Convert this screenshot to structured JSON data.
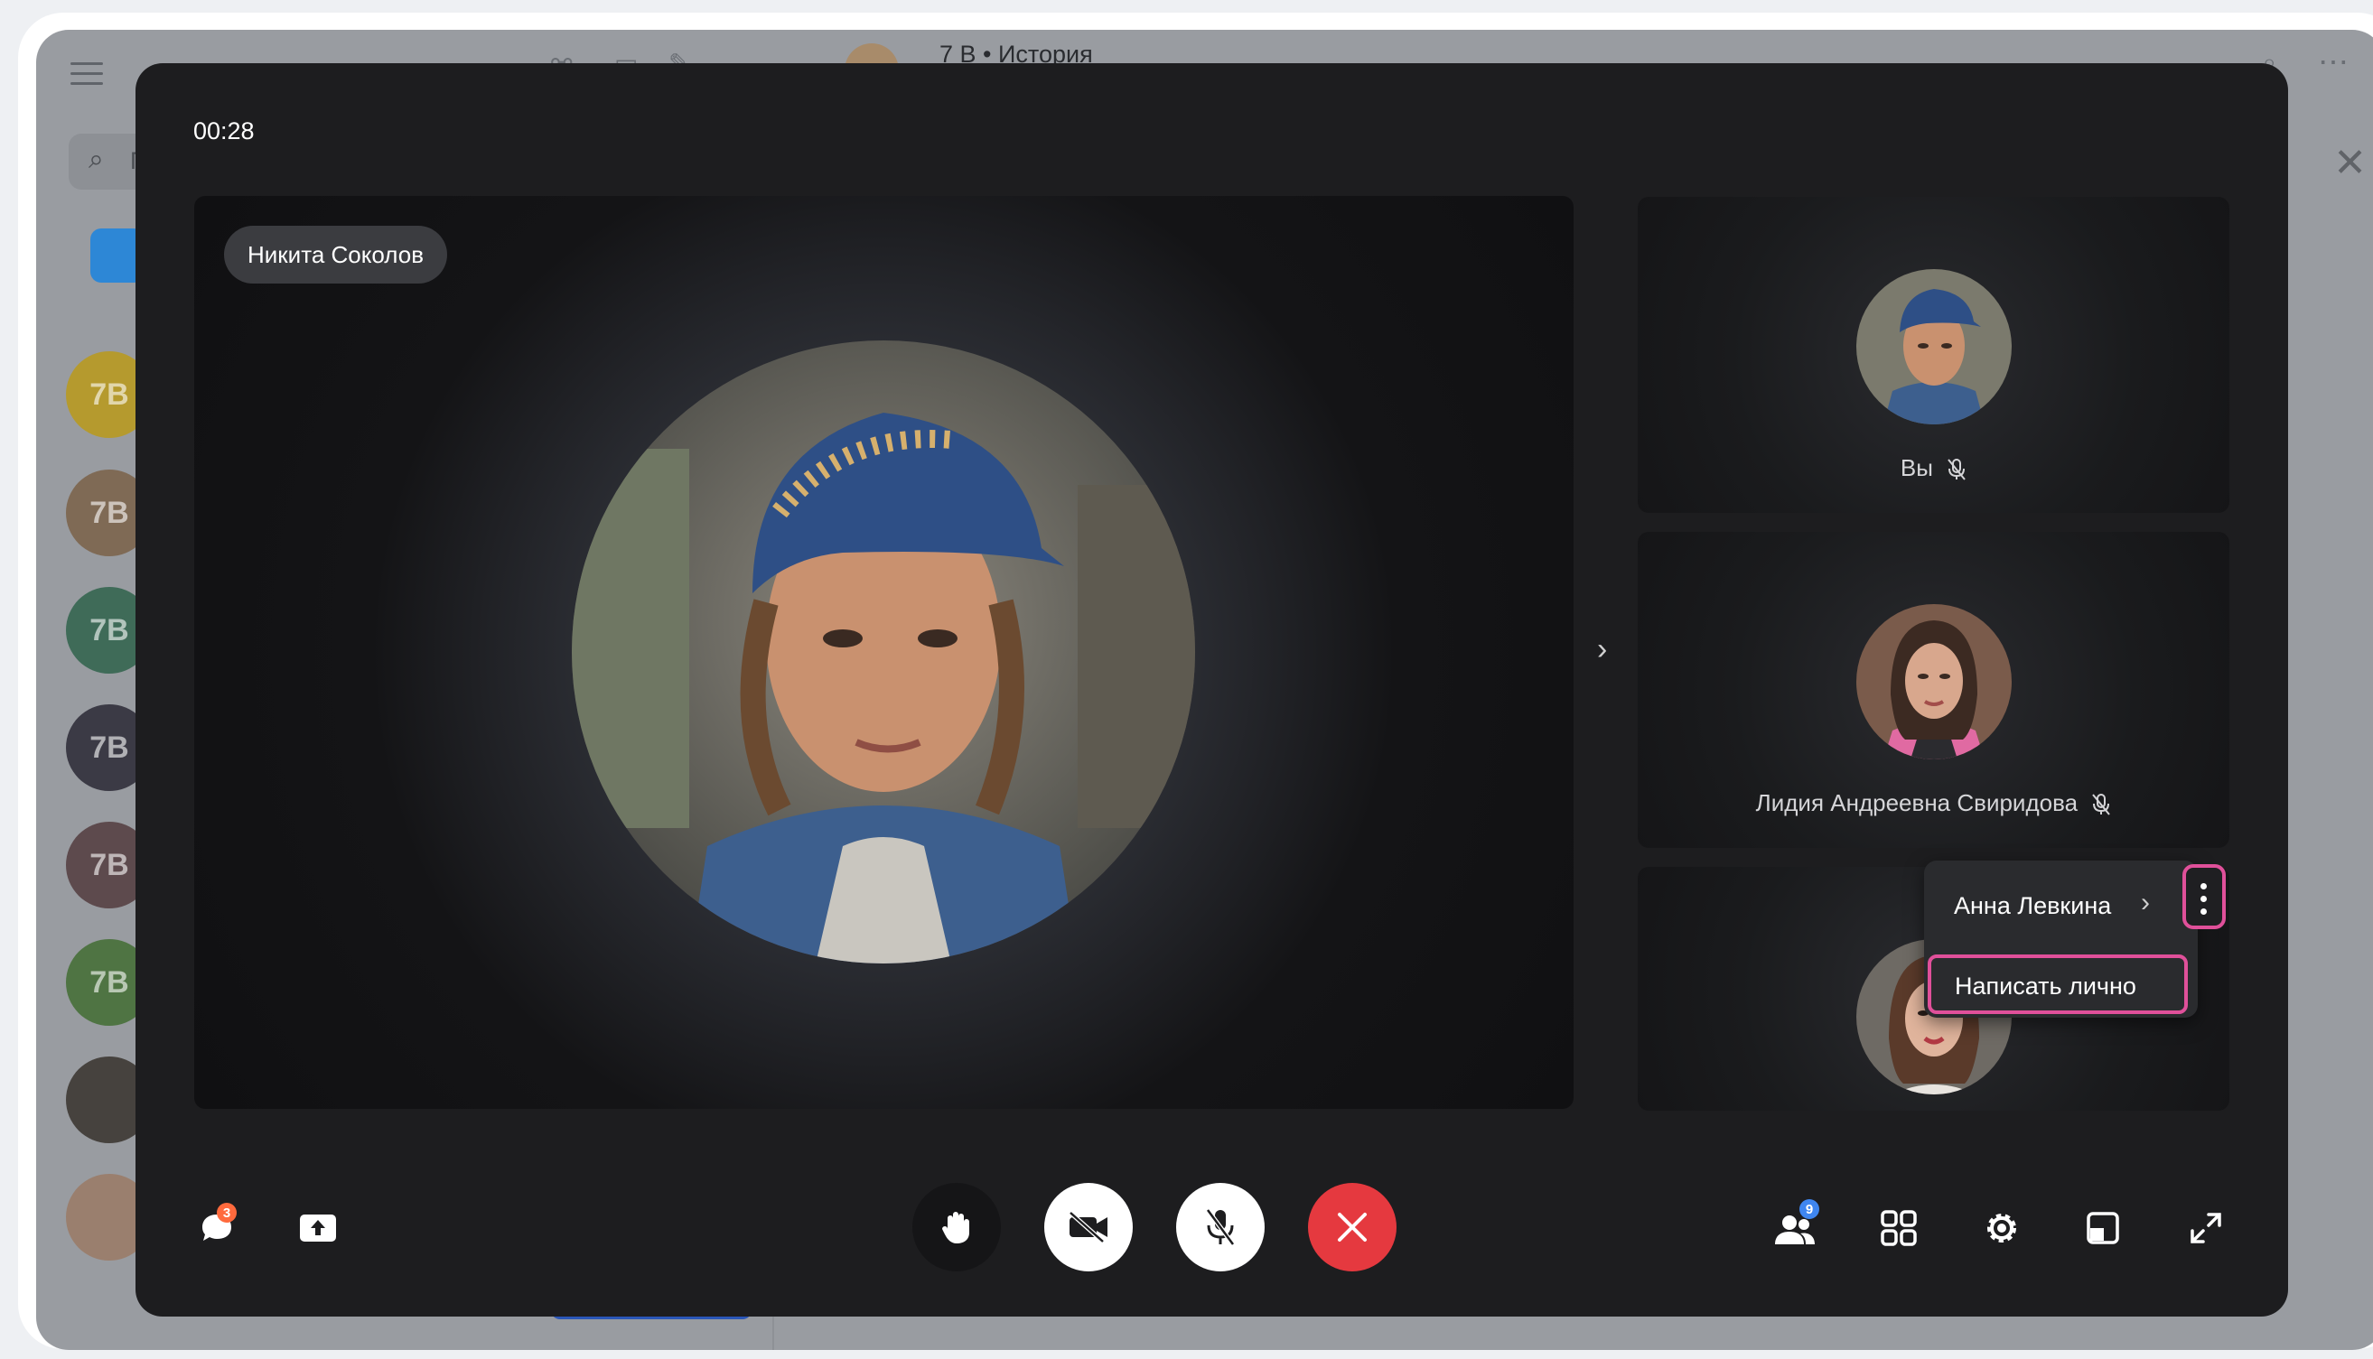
{
  "background_app": {
    "chat_title": "7 В • История",
    "search_placeholder": "П",
    "class_avatars": [
      "7В",
      "7В",
      "7В",
      "7В",
      "7В",
      "7В"
    ]
  },
  "call": {
    "timer": "00:28",
    "main_speaker": {
      "name": "Никита Соколов"
    },
    "participants": [
      {
        "name": "Вы",
        "muted": true
      },
      {
        "name": "Лидия Андреевна Свиридова",
        "muted": true
      },
      {
        "name": "Анна Левкина",
        "muted": false
      }
    ],
    "context_menu": {
      "title": "Анна Левкина",
      "items": [
        "Написать лично"
      ]
    },
    "controls": {
      "chat_unread": "3",
      "participants_count": "9",
      "end_call_color": "#e5393f"
    },
    "highlight_color": "#e0509a"
  }
}
